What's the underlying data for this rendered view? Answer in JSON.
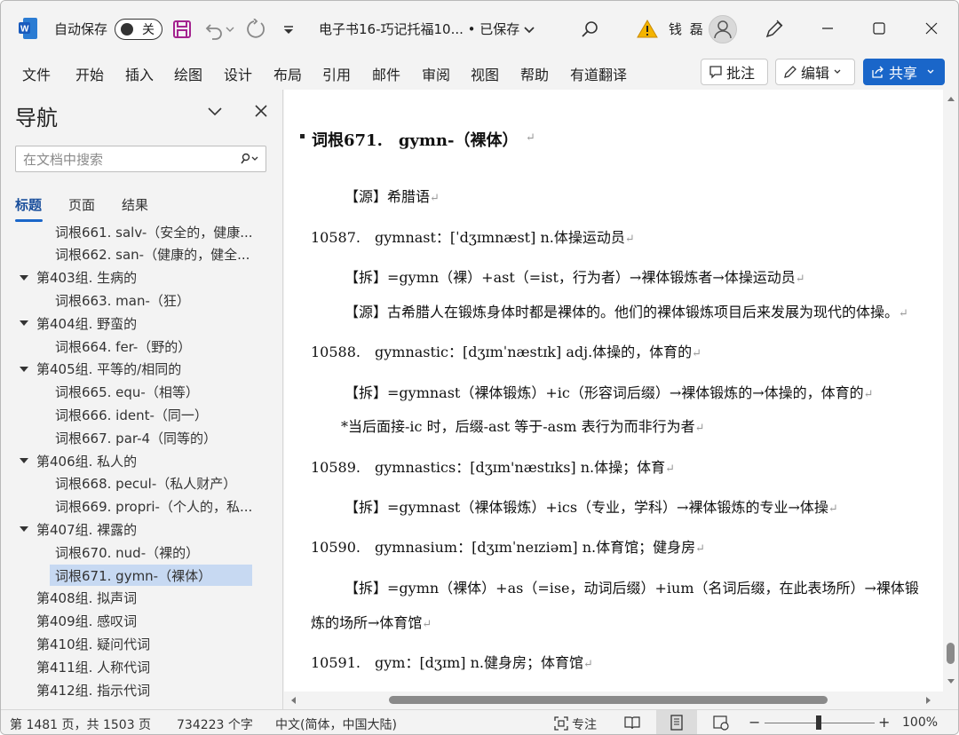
{
  "titlebar": {
    "autosave_label": "自动保存",
    "autosave_state": "关",
    "doc_title": "电子书16-巧记托福10... • 已保存",
    "user_name": "钱 磊",
    "icons": [
      "word-logo-icon",
      "save-icon",
      "undo-icon",
      "redo-icon",
      "customize-icon",
      "search-icon",
      "warning-icon",
      "pen-icon",
      "minimize-icon",
      "maximize-icon",
      "close-icon"
    ]
  },
  "ribbon": {
    "tabs": [
      "文件",
      "开始",
      "插入",
      "绘图",
      "设计",
      "布局",
      "引用",
      "邮件",
      "审阅",
      "视图",
      "帮助",
      "有道翻译"
    ],
    "comment_label": "批注",
    "edit_label": "编辑",
    "share_label": "共享",
    "accent_color": "#1a66c9"
  },
  "nav": {
    "title": "导航",
    "search_placeholder": "在文档中搜索",
    "tabs": [
      "标题",
      "页面",
      "结果"
    ],
    "items": [
      {
        "text": "词根661. salv-（安全的，健康...",
        "level": 2,
        "selected": false
      },
      {
        "text": "词根662. san-（健康的，健全...",
        "level": 2,
        "selected": false
      },
      {
        "text": "第403组. 生病的",
        "level": 1,
        "selected": false
      },
      {
        "text": "词根663. man-（狂）",
        "level": 2,
        "selected": false
      },
      {
        "text": "第404组. 野蛮的",
        "level": 1,
        "selected": false
      },
      {
        "text": "词根664. fer-（野的）",
        "level": 2,
        "selected": false
      },
      {
        "text": "第405组. 平等的/相同的",
        "level": 1,
        "selected": false
      },
      {
        "text": "词根665. equ-（相等）",
        "level": 2,
        "selected": false
      },
      {
        "text": "词根666. ident-（同一）",
        "level": 2,
        "selected": false
      },
      {
        "text": "词根667. par-4（同等的）",
        "level": 2,
        "selected": false
      },
      {
        "text": "第406组. 私人的",
        "level": 1,
        "selected": false
      },
      {
        "text": "词根668. pecul-（私人财产）",
        "level": 2,
        "selected": false
      },
      {
        "text": "词根669. propri-（个人的，私...",
        "level": 2,
        "selected": false
      },
      {
        "text": "第407组. 裸露的",
        "level": 1,
        "selected": false
      },
      {
        "text": "词根670. nud-（裸的）",
        "level": 2,
        "selected": false
      },
      {
        "text": "词根671. gymn-（裸体）",
        "level": 2,
        "selected": true
      },
      {
        "text": "第408组. 拟声词",
        "level": 0,
        "selected": false
      },
      {
        "text": "第409组. 感叹词",
        "level": 0,
        "selected": false
      },
      {
        "text": "第410组. 疑问代词",
        "level": 0,
        "selected": false
      },
      {
        "text": "第411组. 人称代词",
        "level": 0,
        "selected": false
      },
      {
        "text": "第412组. 指示代词",
        "level": 0,
        "selected": false
      }
    ]
  },
  "document": {
    "heading": "词根671.　gymn-（裸体）",
    "lines": [
      "【源】希腊语",
      "10587.　gymnast：[ˈdʒɪmnæst] n.体操运动员",
      "【拆】=gymn（裸）+ast（=ist，行为者）→裸体锻炼者→体操运动员",
      "【源】古希腊人在锻炼身体时都是裸体的。他们的裸体锻炼项目后来发展为现代的体操。",
      "10588.　gymnastic：[dʒɪmˈnæstɪk] adj.体操的，体育的",
      "【拆】=gymnast（裸体锻炼）+ic（形容词后缀）→裸体锻炼的→体操的，体育的",
      "*当后面接-ic 时，后缀-ast 等于-asm 表行为而非行为者",
      "10589.　gymnastics：[dʒɪm'næstɪks] n.体操；体育",
      "【拆】=gymnast（裸体锻炼）+ics（专业，学科）→裸体锻炼的专业→体操",
      "10590.　gymnasium：[dʒɪmˈneɪziəm] n.体育馆；健身房",
      "【拆】=gymn（裸体）+as（=ise，动词后缀）+ium（名词后缀，在此表场所）→裸体锻",
      "炼的场所→体育馆",
      "10591.　gym：[dʒɪm] n.健身房；体育馆"
    ],
    "paragraph_mark": "↵"
  },
  "status": {
    "page": "第 1481 页，共 1503 页",
    "words": "734223 个字",
    "language": "中文(简体，中国大陆)",
    "focus": "专注",
    "zoom_minus": "−",
    "zoom_plus": "+",
    "zoom": "100%",
    "zoom_level": 0.5
  }
}
